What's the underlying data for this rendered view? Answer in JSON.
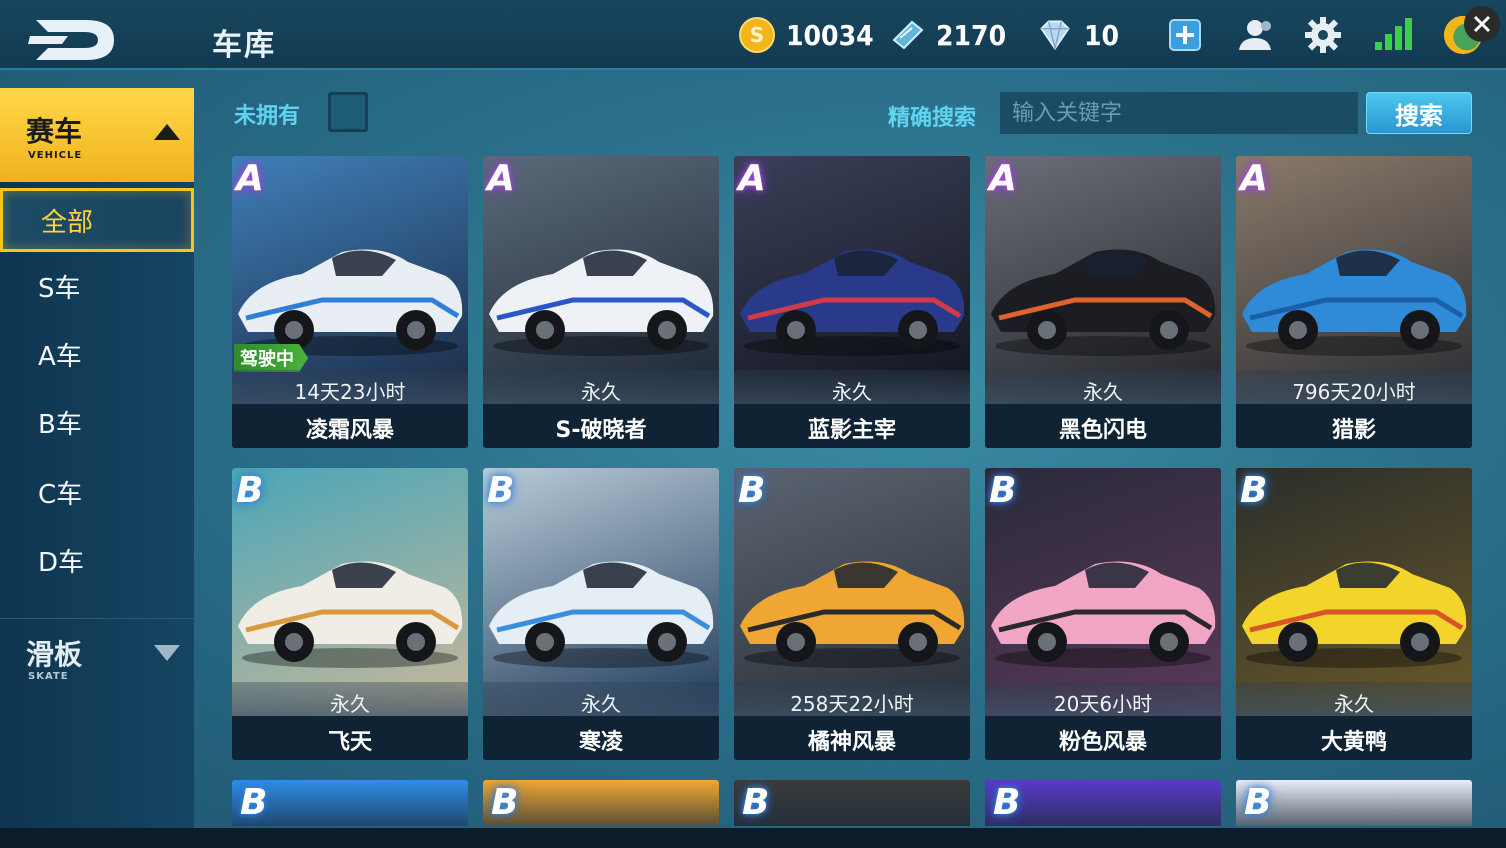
{
  "header": {
    "title": "车库",
    "resources": {
      "gold": "10034",
      "tickets": "2170",
      "diamonds": "10"
    },
    "icons": [
      "logo-icon",
      "add-icon",
      "friends-icon",
      "settings-icon",
      "signal-icon",
      "avatar-icon",
      "close-icon"
    ]
  },
  "sidebar": {
    "category": {
      "cn": "赛车",
      "en": "VEHICLE"
    },
    "items": [
      {
        "label": "全部",
        "active": true
      },
      {
        "label": "S车",
        "active": false
      },
      {
        "label": "A车",
        "active": false
      },
      {
        "label": "B车",
        "active": false
      },
      {
        "label": "C车",
        "active": false
      },
      {
        "label": "D车",
        "active": false
      }
    ],
    "category2": {
      "cn": "滑板",
      "en": "SKATE"
    }
  },
  "filter": {
    "unowned_label": "未拥有",
    "search_label": "精确搜索",
    "search_placeholder": "输入关键字",
    "search_button": "搜索"
  },
  "cards": [
    {
      "rank": "A",
      "duration": "14天23小时",
      "name": "凌霜风暴",
      "badge": "驾驶中",
      "bg1": "#3f7fb8",
      "bg2": "#1b2a44",
      "car": "#e9eef4",
      "accent": "#2f7fd8"
    },
    {
      "rank": "A",
      "duration": "永久",
      "name": "S-破晓者",
      "badge": "",
      "bg1": "#5b6a7a",
      "bg2": "#1d2633",
      "car": "#eef2f6",
      "accent": "#2c55c8"
    },
    {
      "rank": "A",
      "duration": "永久",
      "name": "蓝影主宰",
      "badge": "",
      "bg1": "#3a3f58",
      "bg2": "#12141e",
      "car": "#2a3a8a",
      "accent": "#d23a4a"
    },
    {
      "rank": "A",
      "duration": "永久",
      "name": "黑色闪电",
      "badge": "",
      "bg1": "#6a6e78",
      "bg2": "#222428",
      "car": "#1c1d22",
      "accent": "#e0622c"
    },
    {
      "rank": "A",
      "duration": "796天20小时",
      "name": "猎影",
      "badge": "",
      "bg1": "#8a7a6a",
      "bg2": "#2a2c33",
      "car": "#2f8ad8",
      "accent": "#1a5fa8"
    },
    {
      "rank": "B",
      "duration": "永久",
      "name": "飞天",
      "badge": "",
      "bg1": "#4aa6b8",
      "bg2": "#c9b89a",
      "car": "#f0ede6",
      "accent": "#d89a3a"
    },
    {
      "rank": "B",
      "duration": "永久",
      "name": "寒凌",
      "badge": "",
      "bg1": "#b8ccd8",
      "bg2": "#1f3a5a",
      "car": "#e6eef5",
      "accent": "#3a8ee0"
    },
    {
      "rank": "B",
      "duration": "258天22小时",
      "name": "橘神风暴",
      "badge": "",
      "bg1": "#5a6470",
      "bg2": "#2a2f38",
      "car": "#f0a632",
      "accent": "#2a2a2a"
    },
    {
      "rank": "B",
      "duration": "20天6小时",
      "name": "粉色风暴",
      "badge": "",
      "bg1": "#2a2a3a",
      "bg2": "#5a3a5a",
      "car": "#f2a6c6",
      "accent": "#2a2a2a"
    },
    {
      "rank": "B",
      "duration": "永久",
      "name": "大黄鸭",
      "badge": "",
      "bg1": "#2a2d2a",
      "bg2": "#6a5a2a",
      "car": "#f2d42a",
      "accent": "#d8552a"
    }
  ],
  "partial_cards": [
    {
      "rank": "B",
      "bg": "#2f8ee8"
    },
    {
      "rank": "B",
      "bg": "#f0a830"
    },
    {
      "rank": "B",
      "bg": "#3a3a3a"
    },
    {
      "rank": "B",
      "bg": "#5a3ac8"
    },
    {
      "rank": "B",
      "bg": "#e8eef5"
    }
  ]
}
